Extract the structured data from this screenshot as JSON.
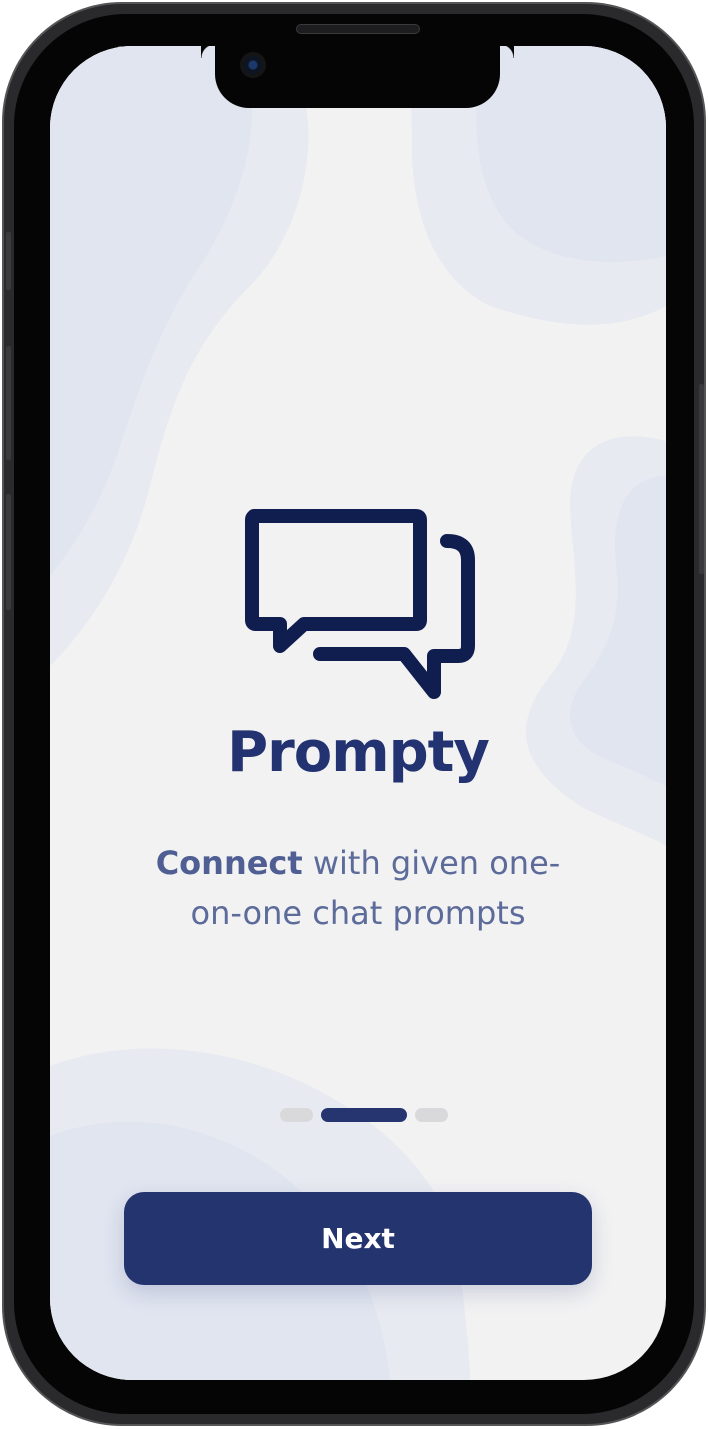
{
  "app": {
    "name": "Prompty",
    "tagline_bold": "Connect",
    "tagline_rest": " with given one-on-one chat prompts"
  },
  "onboarding": {
    "page_indicator": {
      "total": 3,
      "current": 2
    },
    "next_label": "Next"
  },
  "icons": {
    "hero": "chat-bubbles-icon"
  },
  "colors": {
    "primary": "#24346F",
    "title": "#233270",
    "subtitle": "#5C6B9A",
    "background": "#F2F2F3",
    "dot_inactive": "#D9D9DC"
  }
}
